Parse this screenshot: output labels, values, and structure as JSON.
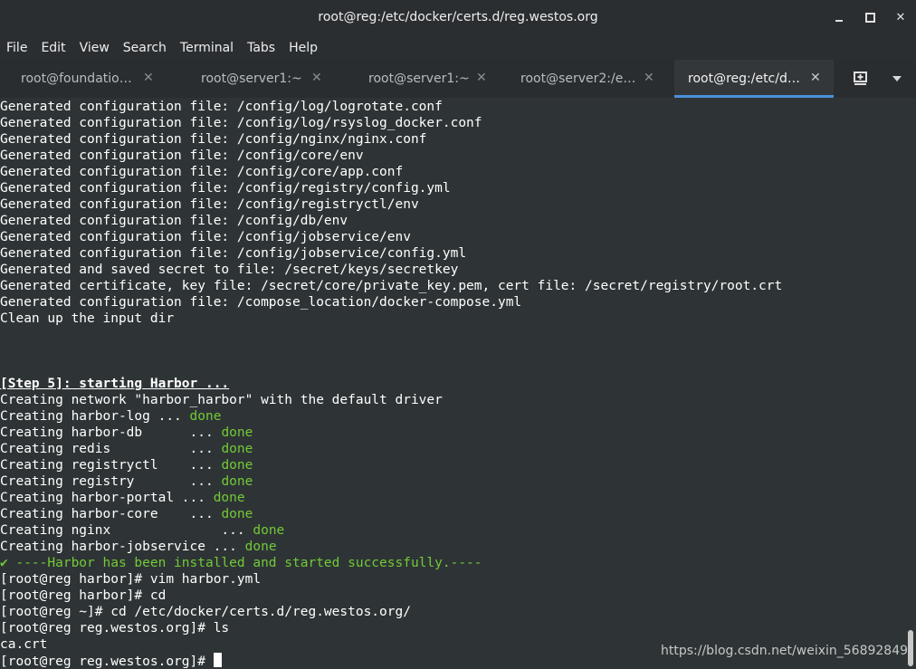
{
  "window": {
    "title": "root@reg:/etc/docker/certs.d/reg.westos.org"
  },
  "menu": [
    "File",
    "Edit",
    "View",
    "Search",
    "Terminal",
    "Tabs",
    "Help"
  ],
  "tabs": [
    {
      "label": "root@foundatio…",
      "active": false
    },
    {
      "label": "root@server1:~",
      "active": false
    },
    {
      "label": "root@server1:~",
      "active": false
    },
    {
      "label": "root@server2:/e…",
      "active": false
    },
    {
      "label": "root@reg:/etc/d…",
      "active": true
    }
  ],
  "terminal": {
    "lines": [
      {
        "text": "Generated configuration file: /config/log/logrotate.conf"
      },
      {
        "text": "Generated configuration file: /config/log/rsyslog_docker.conf"
      },
      {
        "text": "Generated configuration file: /config/nginx/nginx.conf"
      },
      {
        "text": "Generated configuration file: /config/core/env"
      },
      {
        "text": "Generated configuration file: /config/core/app.conf"
      },
      {
        "text": "Generated configuration file: /config/registry/config.yml"
      },
      {
        "text": "Generated configuration file: /config/registryctl/env"
      },
      {
        "text": "Generated configuration file: /config/db/env"
      },
      {
        "text": "Generated configuration file: /config/jobservice/env"
      },
      {
        "text": "Generated configuration file: /config/jobservice/config.yml"
      },
      {
        "text": "Generated and saved secret to file: /secret/keys/secretkey"
      },
      {
        "text": "Generated certificate, key file: /secret/core/private_key.pem, cert file: /secret/registry/root.crt"
      },
      {
        "text": "Generated configuration file: /compose_location/docker-compose.yml"
      },
      {
        "text": "Clean up the input dir"
      },
      {
        "text": ""
      },
      {
        "text": ""
      },
      {
        "text": ""
      },
      {
        "text": "[Step 5]: starting Harbor ...",
        "style": "bold"
      },
      {
        "text": "Creating network \"harbor_harbor\" with the default driver"
      },
      {
        "text": "Creating harbor-log ... ",
        "suffix": "done"
      },
      {
        "text": "Creating harbor-db      ... ",
        "suffix": "done"
      },
      {
        "text": "Creating redis          ... ",
        "suffix": "done"
      },
      {
        "text": "Creating registryctl    ... ",
        "suffix": "done"
      },
      {
        "text": "Creating registry       ... ",
        "suffix": "done"
      },
      {
        "text": "Creating harbor-portal ... ",
        "suffix": "done"
      },
      {
        "text": "Creating harbor-core    ... ",
        "suffix": "done"
      },
      {
        "text": "Creating nginx              ... ",
        "suffix": "done"
      },
      {
        "text": "Creating harbor-jobservice ... ",
        "suffix": "done"
      },
      {
        "text": "✔ ----Harbor has been installed and started successfully.----",
        "style": "ok"
      },
      {
        "text": "[root@reg harbor]# vim harbor.yml"
      },
      {
        "text": "[root@reg harbor]# cd"
      },
      {
        "text": "[root@reg ~]# cd /etc/docker/certs.d/reg.westos.org/"
      },
      {
        "text": "[root@reg reg.westos.org]# ls"
      },
      {
        "text": "ca.crt"
      },
      {
        "text": "[root@reg reg.westos.org]# ",
        "cursor": true
      }
    ]
  },
  "watermark": "https://blog.csdn.net/weixin_56892849",
  "colors": {
    "background": "#2e3436",
    "success": "#73c936",
    "active_tab_underline": "#4a90d9"
  }
}
